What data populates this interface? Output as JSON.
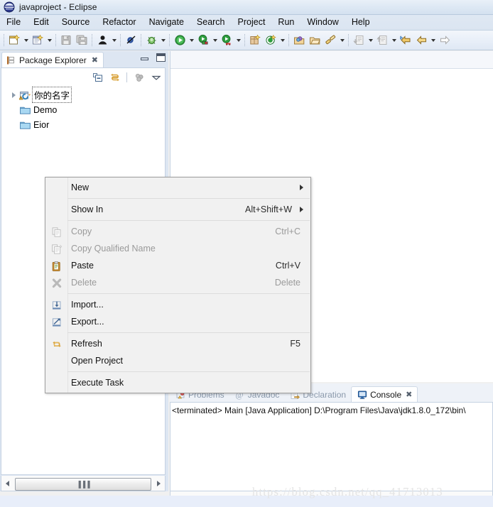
{
  "window": {
    "title": "javaproject - Eclipse",
    "app_icon": "eclipse-icon"
  },
  "menubar": {
    "items": [
      {
        "label": "File",
        "name": "menu-file"
      },
      {
        "label": "Edit",
        "name": "menu-edit"
      },
      {
        "label": "Source",
        "name": "menu-source"
      },
      {
        "label": "Refactor",
        "name": "menu-refactor"
      },
      {
        "label": "Navigate",
        "name": "menu-navigate"
      },
      {
        "label": "Search",
        "name": "menu-search"
      },
      {
        "label": "Project",
        "name": "menu-project"
      },
      {
        "label": "Run",
        "name": "menu-run"
      },
      {
        "label": "Window",
        "name": "menu-window"
      },
      {
        "label": "Help",
        "name": "menu-help"
      }
    ]
  },
  "toolbar": {
    "buttons": [
      "new-wizard-icon",
      "dropdown-arrow",
      "new-java-class-icon",
      "dropdown-arrow",
      "save-icon",
      "save-all-icon",
      "person-icon",
      "dropdown-arrow",
      "skip-breakpoints-icon",
      "debug-icon",
      "dropdown-arrow",
      "run-icon",
      "dropdown-arrow",
      "run-external-icon",
      "dropdown-arrow",
      "coverage-icon",
      "dropdown-arrow",
      "new-package-icon",
      "new-class-icon",
      "dropdown-arrow",
      "open-type-icon",
      "open-task-icon",
      "search-icon",
      "dropdown-arrow",
      "next-annotation-icon",
      "dropdown-arrow",
      "previous-annotation-icon",
      "dropdown-arrow",
      "last-edit-location-icon",
      "back-icon",
      "dropdown-arrow",
      "forward-icon"
    ]
  },
  "package_explorer": {
    "tab_label": "Package Explorer",
    "tab_close": "✖",
    "view_toolbar": [
      {
        "name": "collapse-all-icon",
        "label": "Collapse All"
      },
      {
        "name": "link-with-editor-icon",
        "label": "Link with Editor"
      },
      {
        "name": "focus-on-active-task-icon",
        "label": "Focus on Active Task"
      },
      {
        "name": "view-menu-icon",
        "label": "View Menu"
      }
    ],
    "tree": [
      {
        "label": "你的名字",
        "icon": "java-project-warning-icon",
        "expandable": true,
        "selected": true,
        "indent": 0
      },
      {
        "label": "Demo",
        "icon": "folder-icon",
        "expandable": false,
        "selected": false,
        "indent": 1
      },
      {
        "label": "Eior",
        "icon": "folder-icon",
        "expandable": false,
        "selected": false,
        "indent": 1
      }
    ],
    "scroll_grip": "▐▐▐"
  },
  "context_menu": {
    "items": [
      {
        "label": "New",
        "accel": "",
        "icon": "",
        "disabled": false,
        "submenu": true,
        "name": "ctx-new"
      },
      {
        "type": "separator"
      },
      {
        "label": "Show In",
        "accel": "Alt+Shift+W",
        "icon": "",
        "disabled": false,
        "submenu": true,
        "name": "ctx-show-in"
      },
      {
        "type": "separator"
      },
      {
        "label": "Copy",
        "accel": "Ctrl+C",
        "icon": "copy-icon",
        "disabled": true,
        "submenu": false,
        "name": "ctx-copy"
      },
      {
        "label": "Copy Qualified Name",
        "accel": "",
        "icon": "copy-qualified-name-icon",
        "disabled": true,
        "submenu": false,
        "name": "ctx-copy-qualified-name"
      },
      {
        "label": "Paste",
        "accel": "Ctrl+V",
        "icon": "paste-icon",
        "disabled": false,
        "submenu": false,
        "name": "ctx-paste"
      },
      {
        "label": "Delete",
        "accel": "Delete",
        "icon": "delete-icon",
        "disabled": true,
        "submenu": false,
        "name": "ctx-delete"
      },
      {
        "type": "separator"
      },
      {
        "label": "Import...",
        "accel": "",
        "icon": "import-icon",
        "disabled": false,
        "submenu": false,
        "name": "ctx-import"
      },
      {
        "label": "Export...",
        "accel": "",
        "icon": "export-icon",
        "disabled": false,
        "submenu": false,
        "name": "ctx-export"
      },
      {
        "type": "separator"
      },
      {
        "label": "Refresh",
        "accel": "F5",
        "icon": "refresh-icon",
        "disabled": false,
        "submenu": false,
        "name": "ctx-refresh"
      },
      {
        "label": "Open Project",
        "accel": "",
        "icon": "",
        "disabled": false,
        "submenu": false,
        "name": "ctx-open-project"
      },
      {
        "type": "separator"
      },
      {
        "label": "Execute Task",
        "accel": "",
        "icon": "",
        "disabled": false,
        "submenu": false,
        "name": "ctx-execute-task"
      }
    ]
  },
  "bottom_panel": {
    "tabs": [
      {
        "label": "Problems",
        "icon": "problems-icon",
        "active": false,
        "name": "tab-problems"
      },
      {
        "label": "Javadoc",
        "icon": "javadoc-icon",
        "active": false,
        "name": "tab-javadoc"
      },
      {
        "label": "Declaration",
        "icon": "declaration-icon",
        "active": false,
        "name": "tab-declaration"
      },
      {
        "label": "Console",
        "icon": "console-icon",
        "active": true,
        "name": "tab-console",
        "close": "✖"
      }
    ],
    "console_output": "<terminated> Main [Java Application] D:\\Program Files\\Java\\jdk1.8.0_172\\bin\\"
  },
  "watermark": {
    "text": "https://blog.csdn.net/qq_41713013"
  },
  "colors": {
    "titlebar": "#dde8f4",
    "toolbar": "#e7eef8",
    "panel_bg": "#dde6f2",
    "accent": "#3b6ea5",
    "menu_bg": "#f1f1f1",
    "disabled_text": "#9a9a9a"
  }
}
